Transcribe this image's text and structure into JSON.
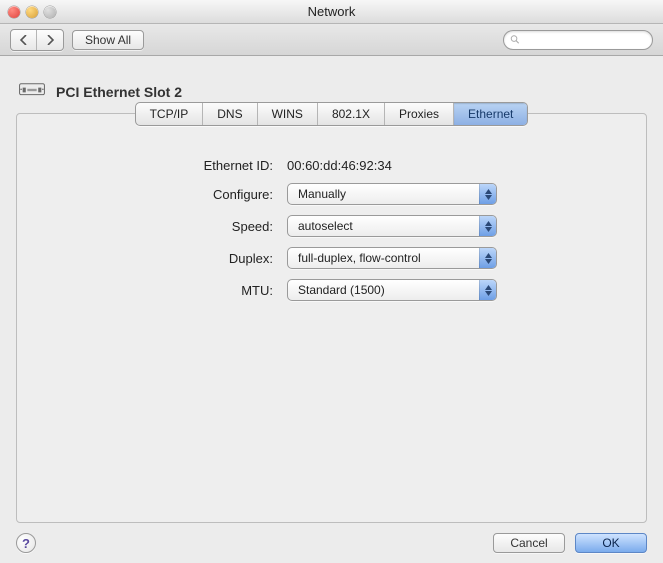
{
  "window": {
    "title": "Network"
  },
  "toolbar": {
    "show_all": "Show All",
    "search_placeholder": ""
  },
  "header": {
    "title": "PCI Ethernet Slot 2"
  },
  "tabs": [
    {
      "label": "TCP/IP"
    },
    {
      "label": "DNS"
    },
    {
      "label": "WINS"
    },
    {
      "label": "802.1X"
    },
    {
      "label": "Proxies"
    },
    {
      "label": "Ethernet",
      "active": true
    }
  ],
  "fields": {
    "ethernet_id_label": "Ethernet ID:",
    "ethernet_id_value": "00:60:dd:46:92:34",
    "configure_label": "Configure:",
    "configure_value": "Manually",
    "speed_label": "Speed:",
    "speed_value": "autoselect",
    "duplex_label": "Duplex:",
    "duplex_value": "full-duplex, flow-control",
    "mtu_label": "MTU:",
    "mtu_value": "Standard  (1500)"
  },
  "buttons": {
    "cancel": "Cancel",
    "ok": "OK",
    "help": "?"
  }
}
